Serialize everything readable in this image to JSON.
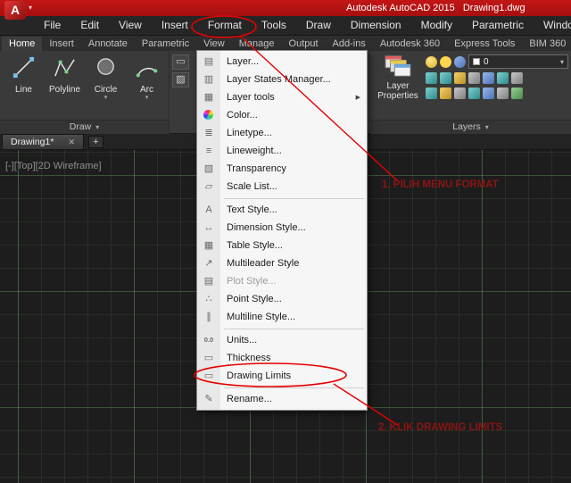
{
  "colors": {
    "titlebar": "#c31616",
    "annotation": "#e60000",
    "annotation_text": "#8b1414"
  },
  "title_bar": {
    "logo_letter": "A",
    "title": "Autodesk AutoCAD 2015   Drawing1.dwg"
  },
  "menu_bar": {
    "items": [
      {
        "label": "File"
      },
      {
        "label": "Edit"
      },
      {
        "label": "View"
      },
      {
        "label": "Insert"
      },
      {
        "label": "Format"
      },
      {
        "label": "Tools"
      },
      {
        "label": "Draw"
      },
      {
        "label": "Dimension"
      },
      {
        "label": "Modify"
      },
      {
        "label": "Parametric"
      },
      {
        "label": "Window"
      }
    ]
  },
  "ribbon": {
    "tabs": [
      {
        "label": "Home",
        "active": true
      },
      {
        "label": "Insert"
      },
      {
        "label": "Annotate"
      },
      {
        "label": "Parametric"
      },
      {
        "label": "View"
      },
      {
        "label": "Manage"
      },
      {
        "label": "Output"
      },
      {
        "label": "Add-ins"
      },
      {
        "label": "Autodesk 360"
      },
      {
        "label": "Express Tools"
      },
      {
        "label": "BIM 360"
      }
    ],
    "draw_panel": {
      "label": "Draw",
      "tools": [
        {
          "label": "Line"
        },
        {
          "label": "Polyline"
        },
        {
          "label": "Circle"
        },
        {
          "label": "Arc"
        }
      ]
    },
    "layers_panel": {
      "label": "Layers",
      "layer_properties_label": "Layer Properties",
      "current_layer": "0"
    }
  },
  "file_tabs": {
    "tabs": [
      {
        "label": "Drawing1*"
      }
    ],
    "close_glyph": "✕",
    "new_tab_label": "+"
  },
  "viewport": {
    "controls": "[-][Top][2D Wireframe]"
  },
  "format_menu": {
    "items": [
      {
        "label": "Layer...",
        "icon": "▤"
      },
      {
        "label": "Layer States Manager...",
        "icon": "▥"
      },
      {
        "label": "Layer tools",
        "icon": "▦",
        "submenu": true
      },
      {
        "label": "Color...",
        "icon": "●",
        "icon_class": "color-wheel"
      },
      {
        "label": "Linetype...",
        "icon": "≣"
      },
      {
        "label": "Lineweight...",
        "icon": "≡"
      },
      {
        "label": "Transparency",
        "icon": "▧"
      },
      {
        "label": "Scale List...",
        "icon": "▱"
      },
      {
        "type": "separator"
      },
      {
        "label": "Text Style...",
        "icon": "A"
      },
      {
        "label": "Dimension Style...",
        "icon": "↔"
      },
      {
        "label": "Table Style...",
        "icon": "▦"
      },
      {
        "label": "Multileader Style",
        "icon": "↗"
      },
      {
        "label": "Plot Style...",
        "icon": "▤",
        "disabled": true
      },
      {
        "label": "Point Style...",
        "icon": "∴"
      },
      {
        "label": "Multiline Style...",
        "icon": "∥"
      },
      {
        "type": "separator"
      },
      {
        "label": "Units...",
        "icon": "0.0",
        "icon_class": "small-text"
      },
      {
        "label": "Thickness",
        "icon": "▭"
      },
      {
        "label": "Drawing Limits",
        "icon": "▭"
      },
      {
        "type": "separator"
      },
      {
        "label": "Rename...",
        "icon": "✎"
      }
    ]
  },
  "annotations": {
    "step1": "1. PILIH MENU FORMAT",
    "step2": "2. KLIK DRAWING LIMITS"
  }
}
